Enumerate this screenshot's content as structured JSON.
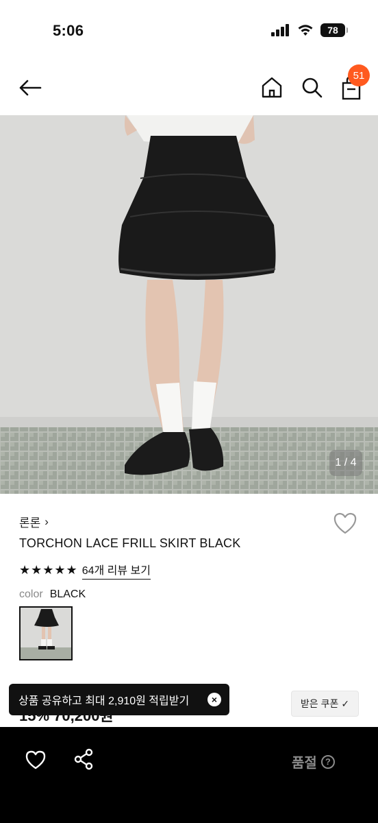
{
  "status": {
    "time": "5:06",
    "battery": "78"
  },
  "nav": {
    "cart_count": "51"
  },
  "gallery": {
    "counter": "1 / 4"
  },
  "product": {
    "brand": "론론",
    "brand_chevron": "›",
    "name": "TORCHON LACE FRILL SKIRT BLACK",
    "stars": "★★★★★",
    "review_link": "64개 리뷰 보기",
    "color_label": "color",
    "color_value": "BLACK",
    "price_peek": "15%  70,200원"
  },
  "toast": {
    "text": "상품 공유하고 최대 2,910원 적립받기",
    "close": "×"
  },
  "coupon": {
    "label": "받은 쿠폰",
    "check": "✓"
  },
  "bottom": {
    "soldout": "품절",
    "help": "?"
  },
  "colors": {
    "badge": "#ff5a1f",
    "bottom_bar": "#000000",
    "soldout": "#8c8c8c"
  }
}
